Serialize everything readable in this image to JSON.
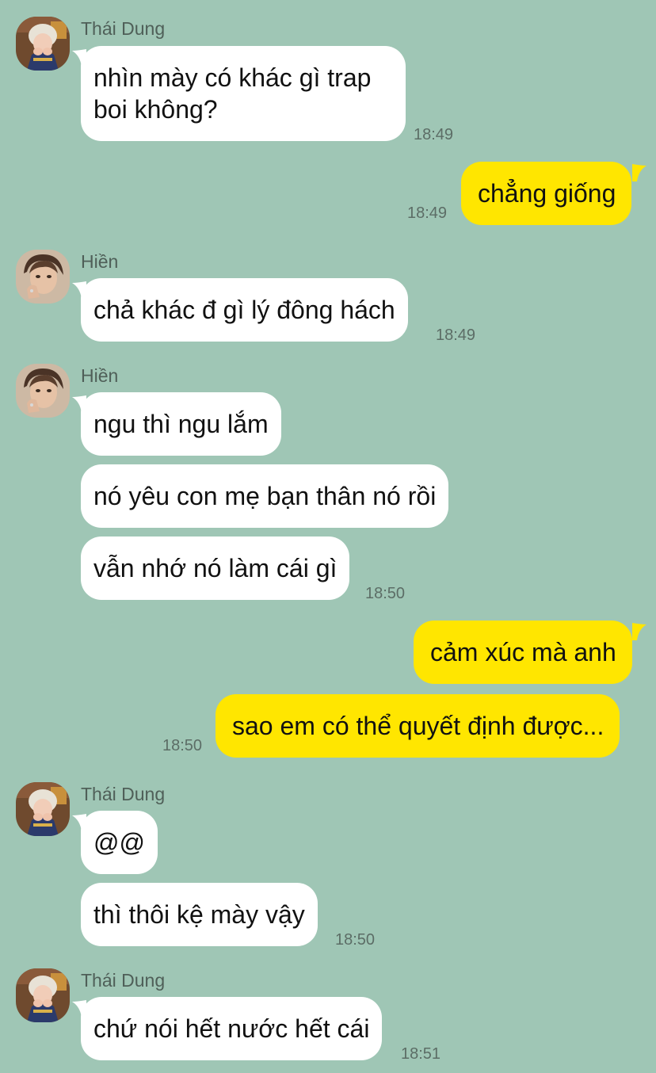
{
  "app": {
    "background_color": "#9fc6b5",
    "incoming_bubble_color": "#ffffff",
    "outgoing_bubble_color": "#ffe600"
  },
  "messages": [
    {
      "sender": "Thái Dung",
      "avatar_icon": "avatar-blonde-person-icon",
      "texts": [
        "nhìn mày có khác gì trap boi không?"
      ],
      "time": "18:49"
    },
    {
      "sender": "me",
      "texts": [
        "chẳng giống"
      ],
      "time": "18:49"
    },
    {
      "sender": "Hiền",
      "avatar_icon": "avatar-person-hand-on-face-icon",
      "texts": [
        "chả khác đ gì lý đông hách"
      ],
      "time": "18:49"
    },
    {
      "sender": "Hiền",
      "avatar_icon": "avatar-person-hand-on-face-icon",
      "texts": [
        "ngu thì ngu lắm",
        "nó yêu con mẹ bạn thân nó rồi",
        "vẫn nhớ nó làm cái gì"
      ],
      "time": "18:50"
    },
    {
      "sender": "me",
      "texts": [
        "cảm xúc mà anh",
        "sao em có thể quyết định được..."
      ],
      "time": "18:50"
    },
    {
      "sender": "Thái Dung",
      "avatar_icon": "avatar-blonde-person-icon",
      "texts": [
        "@@",
        "thì thôi kệ mày vậy"
      ],
      "time": "18:50"
    },
    {
      "sender": "Thái Dung",
      "avatar_icon": "avatar-blonde-person-icon",
      "texts": [
        "chứ nói hết nước hết cái"
      ],
      "time": "18:51"
    }
  ]
}
